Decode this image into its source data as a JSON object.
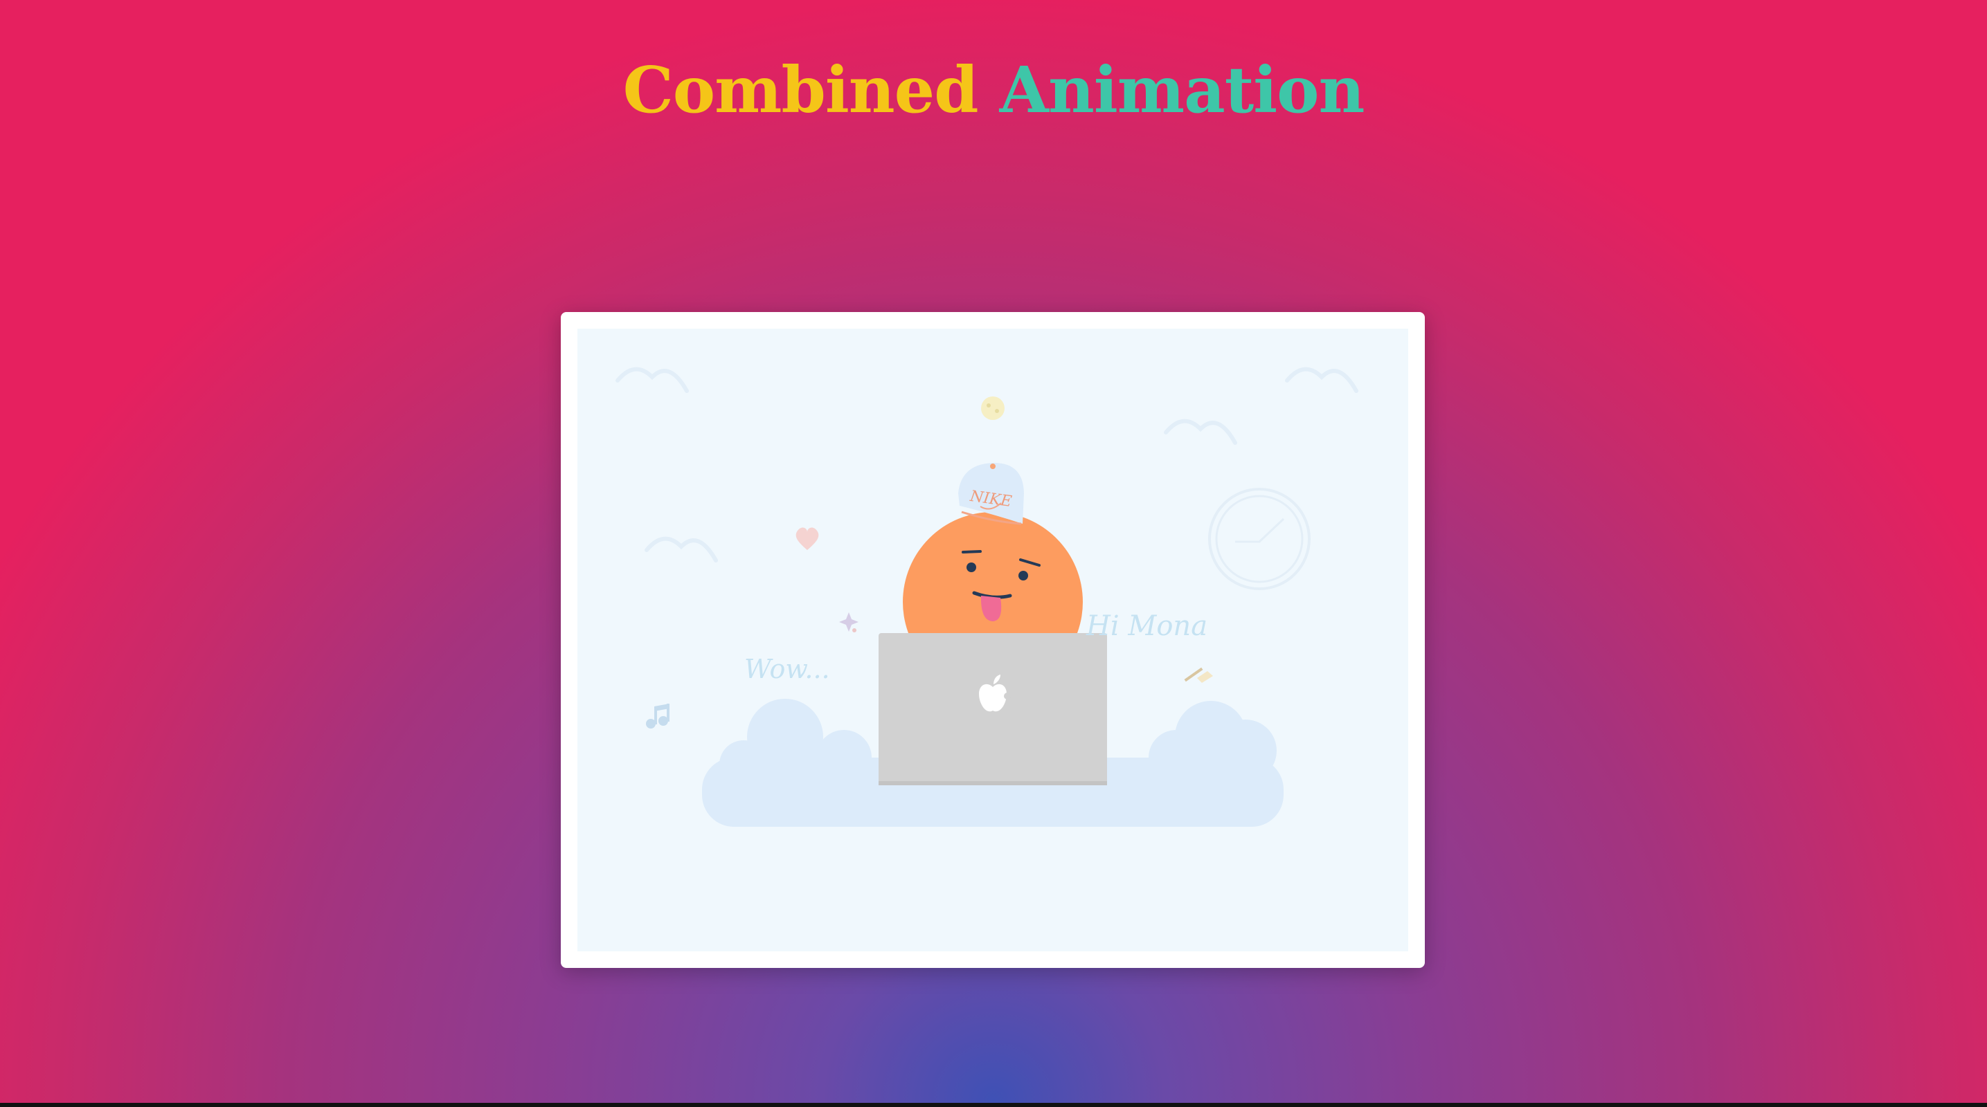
{
  "title": {
    "word1": "Combined",
    "word2": "Animation"
  },
  "scene": {
    "floating_texts": {
      "wow": "Wow...",
      "hi": "Hi Mona"
    },
    "cap_logo": "NIKE",
    "icons": [
      "bird-icon",
      "heart-icon",
      "moon-icon",
      "music-note-icon",
      "writing-hand-icon",
      "sparkle-icon",
      "clock-icon",
      "apple-logo-icon"
    ]
  },
  "colors": {
    "title_word1": "#f5c518",
    "title_word2": "#3ec6a8",
    "face": "#fd9c5f",
    "laptop": "#d1d1d1",
    "cloud": "#dcebfa",
    "scene_bg": "#f0f8fd"
  }
}
